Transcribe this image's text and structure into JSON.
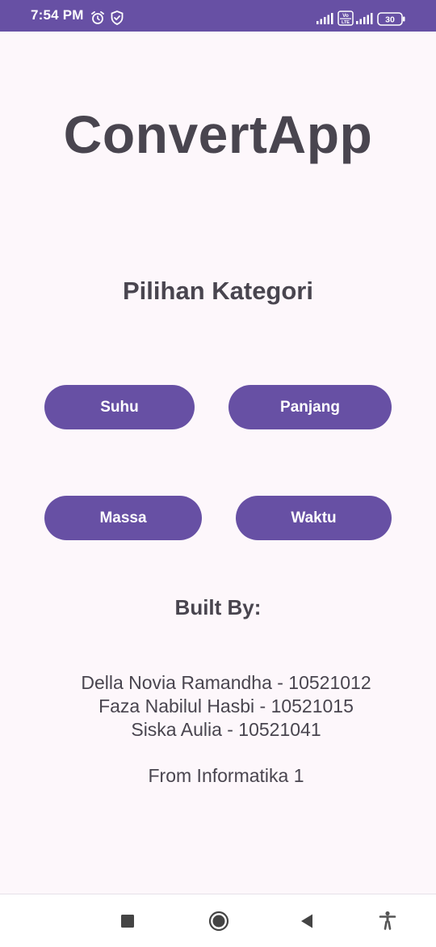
{
  "status_bar": {
    "time": "7:54 PM",
    "battery_level": "30",
    "icons": [
      "alarm-icon",
      "shield-icon",
      "signal-icon",
      "volte-icon",
      "signal-icon",
      "battery-icon"
    ]
  },
  "app": {
    "title": "ConvertApp",
    "section_title": "Pilihan Kategori",
    "categories": [
      {
        "label": "Suhu"
      },
      {
        "label": "Panjang"
      },
      {
        "label": "Massa"
      },
      {
        "label": "Waktu"
      }
    ],
    "built_by_heading": "Built By:",
    "members": [
      "Della Novia Ramandha - 10521012",
      "Faza Nabilul Hasbi - 10521015",
      "Siska Aulia - 10521041"
    ],
    "from_text": "From Informatika 1"
  },
  "colors": {
    "primary": "#6750a4",
    "text": "#49454f",
    "background": "#fdf7fb"
  },
  "nav_bar": {
    "buttons": [
      "recents-square-icon",
      "home-circle-icon",
      "back-triangle-icon",
      "accessibility-icon"
    ]
  }
}
